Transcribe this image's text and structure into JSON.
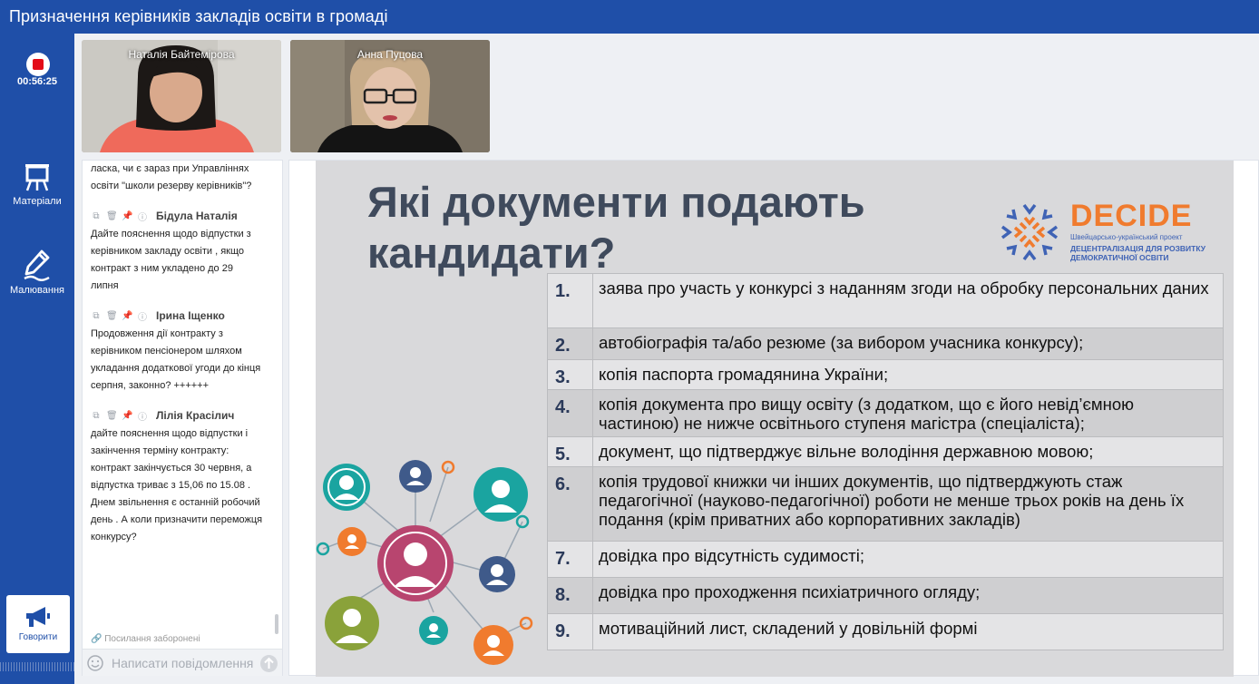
{
  "header": {
    "title": "Призначення керівників закладів освіти в громаді"
  },
  "sidebar": {
    "timer": "00:56:25",
    "materials_label": "Матеріали",
    "drawing_label": "Малювання",
    "talk_label": "Говорити"
  },
  "videos": [
    {
      "name": "Наталія Байтемірова"
    },
    {
      "name": "Анна Пуцова"
    }
  ],
  "chat": {
    "top_fragment": "ласка, чи є зараз при Управліннях освіти \"школи резерву керівників\"?",
    "messages": [
      {
        "author": "Бідула Наталія",
        "text": "Дайте пояснення щодо відпустки з керівником закладу освіти , якщо контракт з ним укладено до 29 липня"
      },
      {
        "author": "Ірина Іщенко",
        "text": "Продовження дії контракту з керівником пенсіонером шляхом укладання додаткової угоди до кінця серпня, законно? ++++++"
      },
      {
        "author": "Лілія Красілич",
        "text": "дайте пояснення щодо відпустки і закінчення терміну контракту: контракт закінчується 30 червня, а відпустка триває з 15,06 по 15.08 . Днем звільнення є останній робочий день . А коли призначити переможця конкурсу?"
      }
    ],
    "links_note": "Посилання заборонені",
    "input_placeholder": "Написати повідомлення"
  },
  "slide": {
    "title": "Які документи подають кандидати?",
    "logo": {
      "word": "DECIDE",
      "sub1": "Швейцарсько-український проект",
      "sub2_line1": "ДЕЦЕНТРАЛІЗАЦІЯ ДЛЯ РОЗВИТКУ",
      "sub2_line2": "ДЕМОКРАТИЧНОЇ ОСВІТИ"
    },
    "items": [
      {
        "num": "1.",
        "text": "заява про участь у конкурсі з наданням згоди на обробку персональних даних"
      },
      {
        "num": "2.",
        "text": "автобіографія та/або резюме (за вибором учасника конкурсу);"
      },
      {
        "num": "3.",
        "text": "копія паспорта громадянина України;"
      },
      {
        "num": "4.",
        "text": "копія документа про вищу освіту (з додатком, що є його невід’ємною частиною) не нижче освітнього ступеня магістра (спеціаліста);"
      },
      {
        "num": "5.",
        "text": "документ, що підтверджує вільне володіння державною мовою;"
      },
      {
        "num": "6.",
        "text": "копія трудової книжки чи інших документів, що підтверджують стаж педагогічної (науково-педагогічної) роботи не менше трьох років на день їх подання (крім приватних або корпоративних закладів)"
      },
      {
        "num": "7.",
        "text": "довідка про відсутність судимості;"
      },
      {
        "num": "8.",
        "text": "довідка про проходження психіатричного огляду;"
      },
      {
        "num": "9.",
        "text": "мотиваційний лист, складений у довільній формі"
      }
    ]
  },
  "colors": {
    "brand_blue": "#1f4fa8",
    "record_red": "#e30b17",
    "decide_orange": "#f07b2e",
    "slide_title": "#3f4a5c"
  }
}
